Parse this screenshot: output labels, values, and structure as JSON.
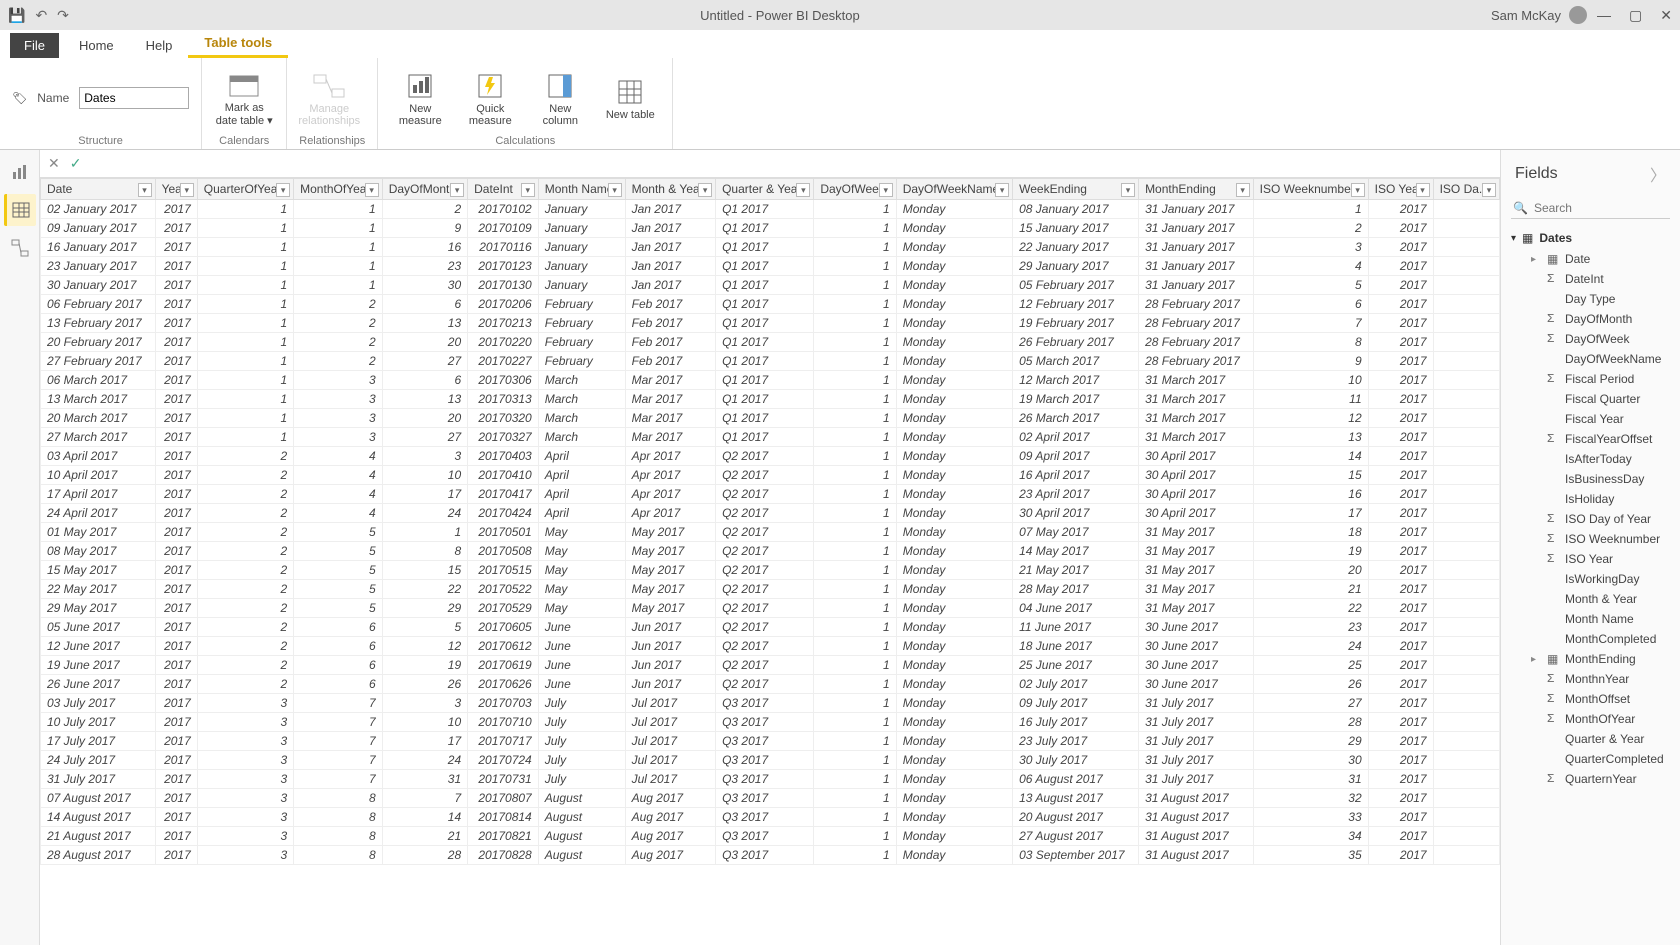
{
  "app": {
    "title": "Untitled - Power BI Desktop",
    "user": "Sam McKay"
  },
  "ribbon": {
    "tabs": {
      "file": "File",
      "home": "Home",
      "help": "Help",
      "tabletools": "Table tools"
    },
    "name_label": "Name",
    "name_value": "Dates",
    "markdate": "Mark as date table ▾",
    "manage_rel": "Manage relationships",
    "new_measure": "New measure",
    "quick_measure": "Quick measure",
    "new_column": "New column",
    "new_table": "New table",
    "g_structure": "Structure",
    "g_calendars": "Calendars",
    "g_relationships": "Relationships",
    "g_calculations": "Calculations"
  },
  "fieldsPane": {
    "title": "Fields",
    "search_placeholder": "Search",
    "table_name": "Dates",
    "fields": [
      {
        "name": "Date",
        "icon": "cal",
        "caret": true
      },
      {
        "name": "DateInt",
        "icon": "sigma"
      },
      {
        "name": "Day Type",
        "icon": ""
      },
      {
        "name": "DayOfMonth",
        "icon": "sigma"
      },
      {
        "name": "DayOfWeek",
        "icon": "sigma"
      },
      {
        "name": "DayOfWeekName",
        "icon": ""
      },
      {
        "name": "Fiscal Period",
        "icon": "sigma"
      },
      {
        "name": "Fiscal Quarter",
        "icon": ""
      },
      {
        "name": "Fiscal Year",
        "icon": ""
      },
      {
        "name": "FiscalYearOffset",
        "icon": "sigma"
      },
      {
        "name": "IsAfterToday",
        "icon": ""
      },
      {
        "name": "IsBusinessDay",
        "icon": ""
      },
      {
        "name": "IsHoliday",
        "icon": ""
      },
      {
        "name": "ISO Day of Year",
        "icon": "sigma"
      },
      {
        "name": "ISO Weeknumber",
        "icon": "sigma"
      },
      {
        "name": "ISO Year",
        "icon": "sigma"
      },
      {
        "name": "IsWorkingDay",
        "icon": ""
      },
      {
        "name": "Month & Year",
        "icon": ""
      },
      {
        "name": "Month Name",
        "icon": ""
      },
      {
        "name": "MonthCompleted",
        "icon": ""
      },
      {
        "name": "MonthEnding",
        "icon": "cal",
        "caret": true
      },
      {
        "name": "MonthnYear",
        "icon": "sigma"
      },
      {
        "name": "MonthOffset",
        "icon": "sigma"
      },
      {
        "name": "MonthOfYear",
        "icon": "sigma"
      },
      {
        "name": "Quarter & Year",
        "icon": ""
      },
      {
        "name": "QuarterCompleted",
        "icon": ""
      },
      {
        "name": "QuarternYear",
        "icon": "sigma"
      }
    ]
  },
  "columns": [
    "Date",
    "Year",
    "QuarterOfYear",
    "MonthOfYear",
    "DayOfMonth",
    "DateInt",
    "Month Name",
    "Month & Year",
    "Quarter & Year",
    "DayOfWeek",
    "DayOfWeekName",
    "WeekEnding",
    "MonthEnding",
    "ISO Weeknumber",
    "ISO Year",
    "ISO Da..."
  ],
  "colTypes": [
    "txt",
    "num",
    "num",
    "num",
    "num",
    "num",
    "txt",
    "txt",
    "txt",
    "num",
    "txt",
    "txt",
    "txt",
    "num",
    "num",
    "txt"
  ],
  "rows": [
    [
      "02 January 2017",
      "2017",
      "1",
      "1",
      "2",
      "20170102",
      "January",
      "Jan 2017",
      "Q1 2017",
      "1",
      "Monday",
      "08 January 2017",
      "31 January 2017",
      "1",
      "2017",
      ""
    ],
    [
      "09 January 2017",
      "2017",
      "1",
      "1",
      "9",
      "20170109",
      "January",
      "Jan 2017",
      "Q1 2017",
      "1",
      "Monday",
      "15 January 2017",
      "31 January 2017",
      "2",
      "2017",
      ""
    ],
    [
      "16 January 2017",
      "2017",
      "1",
      "1",
      "16",
      "20170116",
      "January",
      "Jan 2017",
      "Q1 2017",
      "1",
      "Monday",
      "22 January 2017",
      "31 January 2017",
      "3",
      "2017",
      ""
    ],
    [
      "23 January 2017",
      "2017",
      "1",
      "1",
      "23",
      "20170123",
      "January",
      "Jan 2017",
      "Q1 2017",
      "1",
      "Monday",
      "29 January 2017",
      "31 January 2017",
      "4",
      "2017",
      ""
    ],
    [
      "30 January 2017",
      "2017",
      "1",
      "1",
      "30",
      "20170130",
      "January",
      "Jan 2017",
      "Q1 2017",
      "1",
      "Monday",
      "05 February 2017",
      "31 January 2017",
      "5",
      "2017",
      ""
    ],
    [
      "06 February 2017",
      "2017",
      "1",
      "2",
      "6",
      "20170206",
      "February",
      "Feb 2017",
      "Q1 2017",
      "1",
      "Monday",
      "12 February 2017",
      "28 February 2017",
      "6",
      "2017",
      ""
    ],
    [
      "13 February 2017",
      "2017",
      "1",
      "2",
      "13",
      "20170213",
      "February",
      "Feb 2017",
      "Q1 2017",
      "1",
      "Monday",
      "19 February 2017",
      "28 February 2017",
      "7",
      "2017",
      ""
    ],
    [
      "20 February 2017",
      "2017",
      "1",
      "2",
      "20",
      "20170220",
      "February",
      "Feb 2017",
      "Q1 2017",
      "1",
      "Monday",
      "26 February 2017",
      "28 February 2017",
      "8",
      "2017",
      ""
    ],
    [
      "27 February 2017",
      "2017",
      "1",
      "2",
      "27",
      "20170227",
      "February",
      "Feb 2017",
      "Q1 2017",
      "1",
      "Monday",
      "05 March 2017",
      "28 February 2017",
      "9",
      "2017",
      ""
    ],
    [
      "06 March 2017",
      "2017",
      "1",
      "3",
      "6",
      "20170306",
      "March",
      "Mar 2017",
      "Q1 2017",
      "1",
      "Monday",
      "12 March 2017",
      "31 March 2017",
      "10",
      "2017",
      ""
    ],
    [
      "13 March 2017",
      "2017",
      "1",
      "3",
      "13",
      "20170313",
      "March",
      "Mar 2017",
      "Q1 2017",
      "1",
      "Monday",
      "19 March 2017",
      "31 March 2017",
      "11",
      "2017",
      ""
    ],
    [
      "20 March 2017",
      "2017",
      "1",
      "3",
      "20",
      "20170320",
      "March",
      "Mar 2017",
      "Q1 2017",
      "1",
      "Monday",
      "26 March 2017",
      "31 March 2017",
      "12",
      "2017",
      ""
    ],
    [
      "27 March 2017",
      "2017",
      "1",
      "3",
      "27",
      "20170327",
      "March",
      "Mar 2017",
      "Q1 2017",
      "1",
      "Monday",
      "02 April 2017",
      "31 March 2017",
      "13",
      "2017",
      ""
    ],
    [
      "03 April 2017",
      "2017",
      "2",
      "4",
      "3",
      "20170403",
      "April",
      "Apr 2017",
      "Q2 2017",
      "1",
      "Monday",
      "09 April 2017",
      "30 April 2017",
      "14",
      "2017",
      ""
    ],
    [
      "10 April 2017",
      "2017",
      "2",
      "4",
      "10",
      "20170410",
      "April",
      "Apr 2017",
      "Q2 2017",
      "1",
      "Monday",
      "16 April 2017",
      "30 April 2017",
      "15",
      "2017",
      ""
    ],
    [
      "17 April 2017",
      "2017",
      "2",
      "4",
      "17",
      "20170417",
      "April",
      "Apr 2017",
      "Q2 2017",
      "1",
      "Monday",
      "23 April 2017",
      "30 April 2017",
      "16",
      "2017",
      ""
    ],
    [
      "24 April 2017",
      "2017",
      "2",
      "4",
      "24",
      "20170424",
      "April",
      "Apr 2017",
      "Q2 2017",
      "1",
      "Monday",
      "30 April 2017",
      "30 April 2017",
      "17",
      "2017",
      ""
    ],
    [
      "01 May 2017",
      "2017",
      "2",
      "5",
      "1",
      "20170501",
      "May",
      "May 2017",
      "Q2 2017",
      "1",
      "Monday",
      "07 May 2017",
      "31 May 2017",
      "18",
      "2017",
      ""
    ],
    [
      "08 May 2017",
      "2017",
      "2",
      "5",
      "8",
      "20170508",
      "May",
      "May 2017",
      "Q2 2017",
      "1",
      "Monday",
      "14 May 2017",
      "31 May 2017",
      "19",
      "2017",
      ""
    ],
    [
      "15 May 2017",
      "2017",
      "2",
      "5",
      "15",
      "20170515",
      "May",
      "May 2017",
      "Q2 2017",
      "1",
      "Monday",
      "21 May 2017",
      "31 May 2017",
      "20",
      "2017",
      ""
    ],
    [
      "22 May 2017",
      "2017",
      "2",
      "5",
      "22",
      "20170522",
      "May",
      "May 2017",
      "Q2 2017",
      "1",
      "Monday",
      "28 May 2017",
      "31 May 2017",
      "21",
      "2017",
      ""
    ],
    [
      "29 May 2017",
      "2017",
      "2",
      "5",
      "29",
      "20170529",
      "May",
      "May 2017",
      "Q2 2017",
      "1",
      "Monday",
      "04 June 2017",
      "31 May 2017",
      "22",
      "2017",
      ""
    ],
    [
      "05 June 2017",
      "2017",
      "2",
      "6",
      "5",
      "20170605",
      "June",
      "Jun 2017",
      "Q2 2017",
      "1",
      "Monday",
      "11 June 2017",
      "30 June 2017",
      "23",
      "2017",
      ""
    ],
    [
      "12 June 2017",
      "2017",
      "2",
      "6",
      "12",
      "20170612",
      "June",
      "Jun 2017",
      "Q2 2017",
      "1",
      "Monday",
      "18 June 2017",
      "30 June 2017",
      "24",
      "2017",
      ""
    ],
    [
      "19 June 2017",
      "2017",
      "2",
      "6",
      "19",
      "20170619",
      "June",
      "Jun 2017",
      "Q2 2017",
      "1",
      "Monday",
      "25 June 2017",
      "30 June 2017",
      "25",
      "2017",
      ""
    ],
    [
      "26 June 2017",
      "2017",
      "2",
      "6",
      "26",
      "20170626",
      "June",
      "Jun 2017",
      "Q2 2017",
      "1",
      "Monday",
      "02 July 2017",
      "30 June 2017",
      "26",
      "2017",
      ""
    ],
    [
      "03 July 2017",
      "2017",
      "3",
      "7",
      "3",
      "20170703",
      "July",
      "Jul 2017",
      "Q3 2017",
      "1",
      "Monday",
      "09 July 2017",
      "31 July 2017",
      "27",
      "2017",
      ""
    ],
    [
      "10 July 2017",
      "2017",
      "3",
      "7",
      "10",
      "20170710",
      "July",
      "Jul 2017",
      "Q3 2017",
      "1",
      "Monday",
      "16 July 2017",
      "31 July 2017",
      "28",
      "2017",
      ""
    ],
    [
      "17 July 2017",
      "2017",
      "3",
      "7",
      "17",
      "20170717",
      "July",
      "Jul 2017",
      "Q3 2017",
      "1",
      "Monday",
      "23 July 2017",
      "31 July 2017",
      "29",
      "2017",
      ""
    ],
    [
      "24 July 2017",
      "2017",
      "3",
      "7",
      "24",
      "20170724",
      "July",
      "Jul 2017",
      "Q3 2017",
      "1",
      "Monday",
      "30 July 2017",
      "31 July 2017",
      "30",
      "2017",
      ""
    ],
    [
      "31 July 2017",
      "2017",
      "3",
      "7",
      "31",
      "20170731",
      "July",
      "Jul 2017",
      "Q3 2017",
      "1",
      "Monday",
      "06 August 2017",
      "31 July 2017",
      "31",
      "2017",
      ""
    ],
    [
      "07 August 2017",
      "2017",
      "3",
      "8",
      "7",
      "20170807",
      "August",
      "Aug 2017",
      "Q3 2017",
      "1",
      "Monday",
      "13 August 2017",
      "31 August 2017",
      "32",
      "2017",
      ""
    ],
    [
      "14 August 2017",
      "2017",
      "3",
      "8",
      "14",
      "20170814",
      "August",
      "Aug 2017",
      "Q3 2017",
      "1",
      "Monday",
      "20 August 2017",
      "31 August 2017",
      "33",
      "2017",
      ""
    ],
    [
      "21 August 2017",
      "2017",
      "3",
      "8",
      "21",
      "20170821",
      "August",
      "Aug 2017",
      "Q3 2017",
      "1",
      "Monday",
      "27 August 2017",
      "31 August 2017",
      "34",
      "2017",
      ""
    ],
    [
      "28 August 2017",
      "2017",
      "3",
      "8",
      "28",
      "20170828",
      "August",
      "Aug 2017",
      "Q3 2017",
      "1",
      "Monday",
      "03 September 2017",
      "31 August 2017",
      "35",
      "2017",
      ""
    ]
  ]
}
